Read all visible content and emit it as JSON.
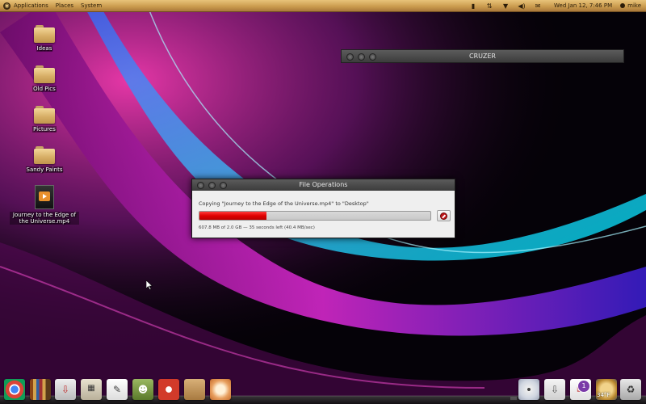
{
  "top_panel": {
    "menus": [
      "Applications",
      "Places",
      "System"
    ],
    "clock": "Wed Jan 12, 7:46 PM",
    "user": "mike",
    "tray_icons": [
      "signal-icon",
      "network-icon",
      "updates-icon",
      "volume-icon",
      "mail-icon"
    ]
  },
  "desktop_icons": [
    {
      "label": "Ideas",
      "type": "folder"
    },
    {
      "label": "Old Pics",
      "type": "folder"
    },
    {
      "label": "Pictures",
      "type": "folder"
    },
    {
      "label": "Sandy Paints",
      "type": "folder"
    },
    {
      "label": "Journey to the Edge of the Universe.mp4",
      "type": "video"
    }
  ],
  "cruzer_window": {
    "title": "CRUZER"
  },
  "file_operations": {
    "title": "File Operations",
    "copying_text": "Copying \"Journey to the Edge of the Universe.mp4\" to \"Desktop\"",
    "progress": 0.29,
    "status_text": "607.8 MB of 2.0 GB — 35 seconds left (40.4 MB/sec)"
  },
  "dock": {
    "icons": [
      "chrome-icon",
      "books-icon",
      "installer-icon",
      "calculator-icon",
      "text-editor-icon",
      "android-icon",
      "music-player-icon",
      "package-icon",
      "shell-icon",
      "dvd-icon",
      "usb-drive-icon",
      "mail-icon",
      "weather-icon",
      "trash-icon"
    ],
    "mail_badge": "1",
    "weather_temp": "34°F"
  },
  "colors": {
    "progress": "#e00000",
    "panel": "#c99a4c",
    "titlebar": "#4a4a4a"
  }
}
